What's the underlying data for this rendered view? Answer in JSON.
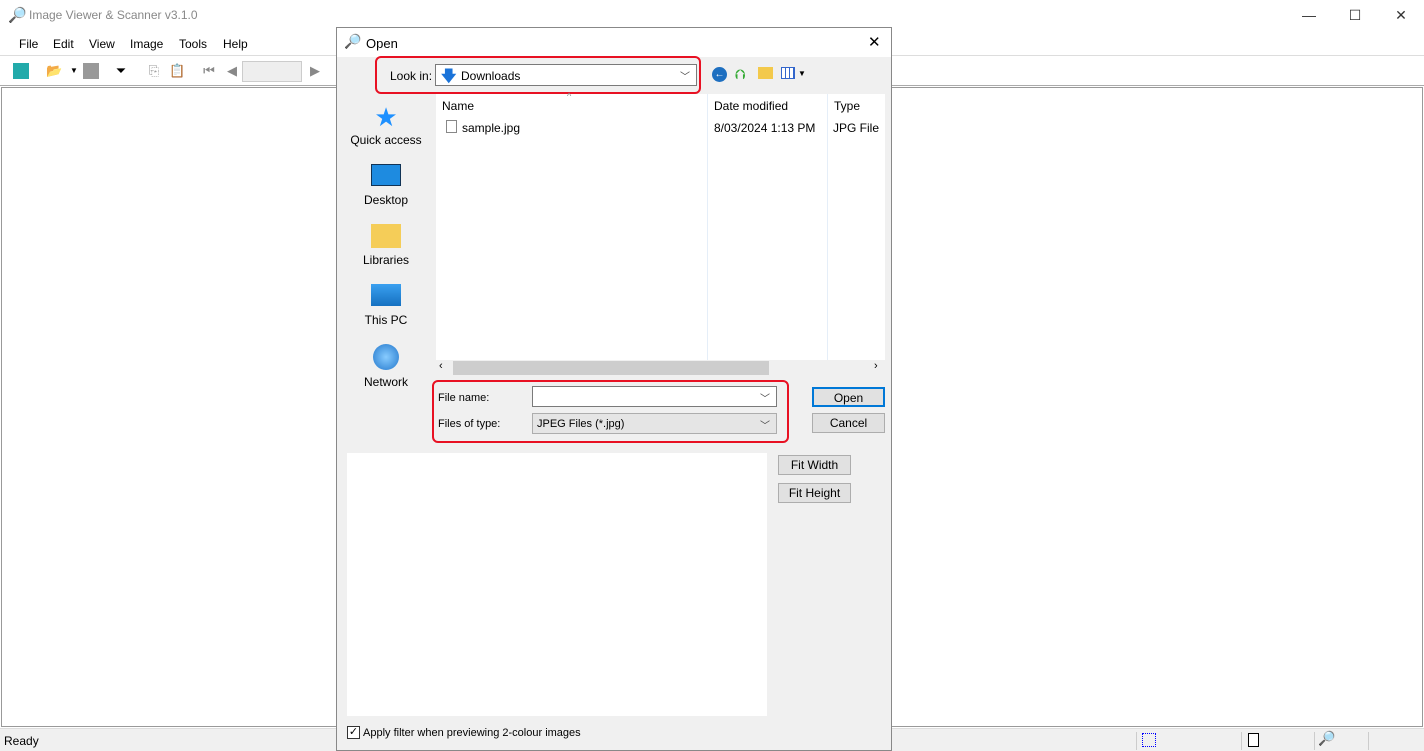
{
  "app": {
    "title": "Image Viewer & Scanner v3.1.0",
    "minimize": "—",
    "maximize": "☐",
    "close": "✕"
  },
  "menu": [
    "File",
    "Edit",
    "View",
    "Image",
    "Tools",
    "Help"
  ],
  "status": {
    "text": "Ready"
  },
  "dialog": {
    "title": "Open",
    "close": "✕",
    "look_in_label": "Look in:",
    "look_in_value": "Downloads",
    "places": [
      "Quick access",
      "Desktop",
      "Libraries",
      "This PC",
      "Network"
    ],
    "columns": [
      "Name",
      "Date modified",
      "Type"
    ],
    "files": [
      {
        "name": "sample.jpg",
        "date": "8/03/2024 1:13 PM",
        "type": "JPG File"
      }
    ],
    "file_name_label": "File name:",
    "file_name_value": "",
    "file_type_label": "Files of type:",
    "file_type_value": "JPEG Files (*.jpg)",
    "open": "Open",
    "cancel": "Cancel",
    "fit_width": "Fit Width",
    "fit_height": "Fit Height",
    "filter_checkbox": "Apply filter when previewing 2-colour images",
    "filter_checked": true
  },
  "colors": {
    "highlight": "#e81123",
    "accent": "#0078d7"
  }
}
